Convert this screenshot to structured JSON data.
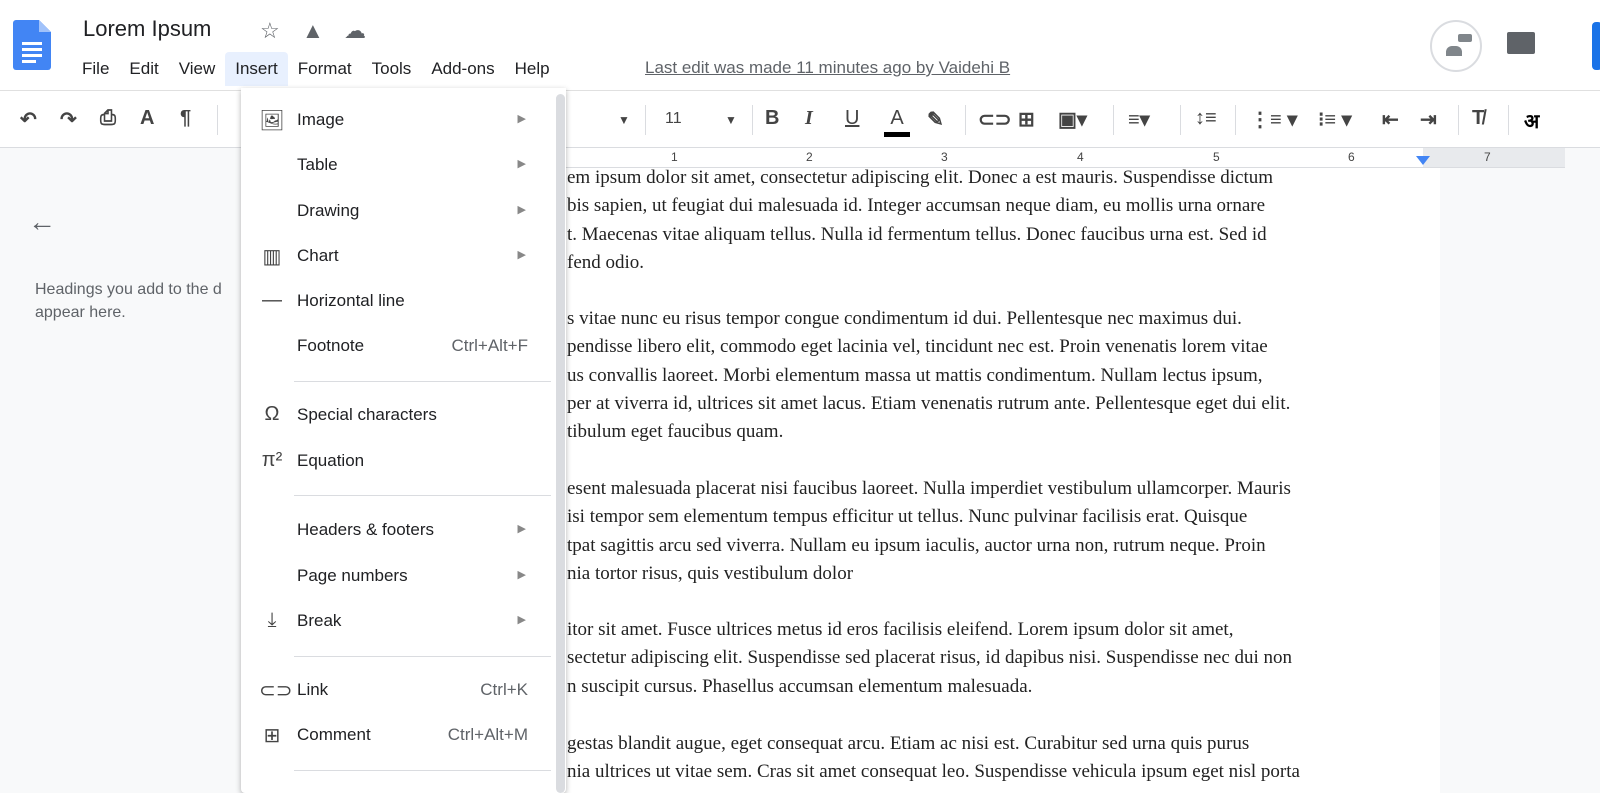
{
  "title": "Lorem Ipsum",
  "menus": [
    "File",
    "Edit",
    "View",
    "Insert",
    "Format",
    "Tools",
    "Add-ons",
    "Help"
  ],
  "last_edit": "Last edit was made 11 minutes ago by Vaidehi B",
  "toolbar": {
    "font_size": "11",
    "input_tool": "अ"
  },
  "ruler": [
    "1",
    "2",
    "3",
    "4",
    "5",
    "6",
    "7"
  ],
  "outline": {
    "hint": "Headings you add to the d\nappear here."
  },
  "insert_menu": [
    {
      "icon": "image-icon",
      "label": "Image",
      "submenu": true
    },
    {
      "icon": "",
      "label": "Table",
      "submenu": true
    },
    {
      "icon": "",
      "label": "Drawing",
      "submenu": true
    },
    {
      "icon": "chart-icon",
      "label": "Chart",
      "submenu": true
    },
    {
      "icon": "horizontal-line-icon",
      "label": "Horizontal line"
    },
    {
      "icon": "",
      "label": "Footnote",
      "shortcut": "Ctrl+Alt+F"
    },
    {
      "icon": "omega-icon",
      "label": "Special characters"
    },
    {
      "icon": "pi-icon",
      "label": "Equation"
    },
    {
      "icon": "",
      "label": "Headers & footers",
      "submenu": true
    },
    {
      "icon": "",
      "label": "Page numbers",
      "submenu": true
    },
    {
      "icon": "break-icon",
      "label": "Break",
      "submenu": true
    },
    {
      "icon": "link-icon",
      "label": "Link",
      "shortcut": "Ctrl+K"
    },
    {
      "icon": "comment-icon",
      "label": "Comment",
      "shortcut": "Ctrl+Alt+M"
    }
  ],
  "paragraphs": [
    [
      "em ipsum dolor sit amet, consectetur adipiscing elit. Donec a est mauris. Suspendisse dictum",
      "bis sapien, ut feugiat dui malesuada id. Integer accumsan neque diam, eu mollis urna ornare",
      "t. Maecenas vitae aliquam tellus. Nulla id fermentum tellus. Donec faucibus urna est. Sed id",
      "fend odio."
    ],
    [
      "s vitae nunc eu risus tempor congue condimentum id dui. Pellentesque nec maximus dui.",
      "pendisse libero elit, commodo eget lacinia vel, tincidunt nec est. Proin venenatis lorem vitae",
      "us convallis laoreet. Morbi elementum massa ut mattis condimentum. Nullam lectus ipsum,",
      "per at viverra id, ultrices sit amet lacus. Etiam venenatis rutrum ante. Pellentesque eget dui elit.",
      "tibulum eget faucibus quam."
    ],
    [
      "esent malesuada placerat nisi faucibus laoreet. Nulla imperdiet vestibulum ullamcorper. Mauris",
      "isi tempor sem elementum tempus efficitur ut tellus. Nunc pulvinar facilisis erat. Quisque",
      "tpat sagittis arcu sed viverra. Nullam eu ipsum iaculis, auctor urna non, rutrum neque. Proin",
      "nia tortor risus, quis vestibulum dolor"
    ],
    [
      "itor sit amet. Fusce ultrices metus id eros facilisis eleifend. Lorem ipsum dolor sit amet,",
      "sectetur adipiscing elit. Suspendisse sed placerat risus, id dapibus nisi. Suspendisse nec dui non",
      "n suscipit cursus. Phasellus accumsan elementum malesuada."
    ],
    [
      "gestas blandit augue, eget consequat arcu. Etiam ac nisi est. Curabitur sed urna quis purus",
      "nia ultrices ut vitae sem. Cras sit amet consequat leo. Suspendisse vehicula ipsum eget nisl porta"
    ]
  ]
}
